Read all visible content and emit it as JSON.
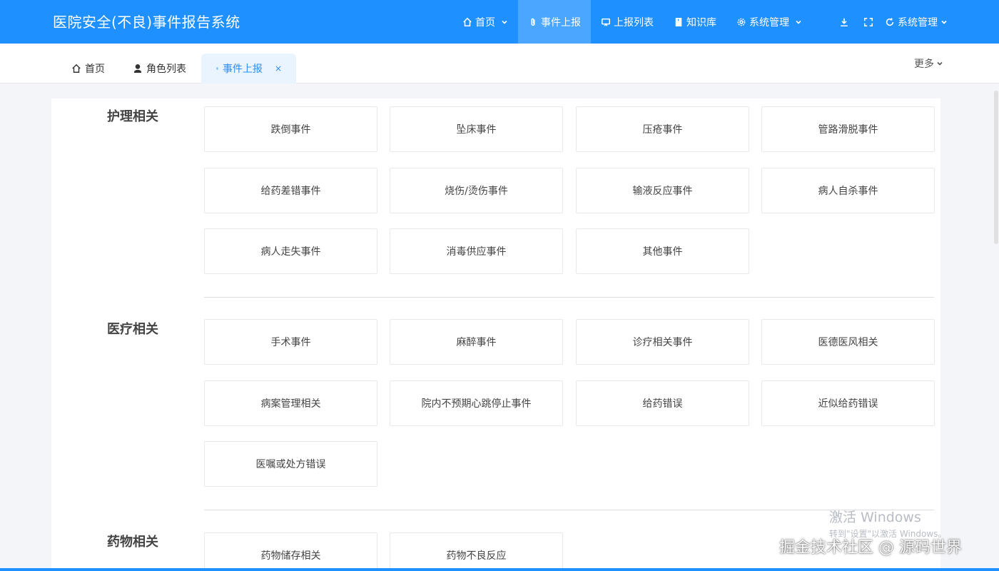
{
  "header": {
    "app_title": "医院安全(不良)事件报告系统",
    "nav": [
      {
        "label": "首页",
        "icon": "home-icon",
        "has_dropdown": true,
        "active": false
      },
      {
        "label": "事件上报",
        "icon": "paperclip-icon",
        "has_dropdown": false,
        "active": true
      },
      {
        "label": "上报列表",
        "icon": "monitor-icon",
        "has_dropdown": false,
        "active": false
      },
      {
        "label": "知识库",
        "icon": "book-icon",
        "has_dropdown": false,
        "active": false
      },
      {
        "label": "系统管理",
        "icon": "gear-icon",
        "has_dropdown": true,
        "active": false
      }
    ],
    "user_menu_label": "系统管理",
    "brand_color": "#1e90ff"
  },
  "tabs": {
    "items": [
      {
        "label": "首页",
        "icon": "home-icon",
        "active": false
      },
      {
        "label": "角色列表",
        "icon": "user-icon",
        "active": false
      },
      {
        "label": "事件上报",
        "icon": "paperclip-icon",
        "active": true,
        "close": "×"
      }
    ],
    "more_label": "更多"
  },
  "sections": [
    {
      "title": "护理相关",
      "items": [
        "跌倒事件",
        "坠床事件",
        "压疮事件",
        "管路滑脱事件",
        "给药差错事件",
        "烧伤/烫伤事件",
        "输液反应事件",
        "病人自杀事件",
        "病人走失事件",
        "消毒供应事件",
        "其他事件"
      ]
    },
    {
      "title": "医疗相关",
      "items": [
        "手术事件",
        "麻醉事件",
        "诊疗相关事件",
        "医德医风相关",
        "病案管理相关",
        "院内不预期心跳停止事件",
        "给药错误",
        "近似给药错误",
        "医嘱或处方错误"
      ]
    },
    {
      "title": "药物相关",
      "items": [
        "药物储存相关",
        "药物不良反应"
      ]
    }
  ],
  "overlay": {
    "activation_line1": "激活 Windows",
    "activation_line2": "转到\"设置\"以激活 Windows。",
    "watermark": "掘金技术社区 @ 源码世界"
  }
}
